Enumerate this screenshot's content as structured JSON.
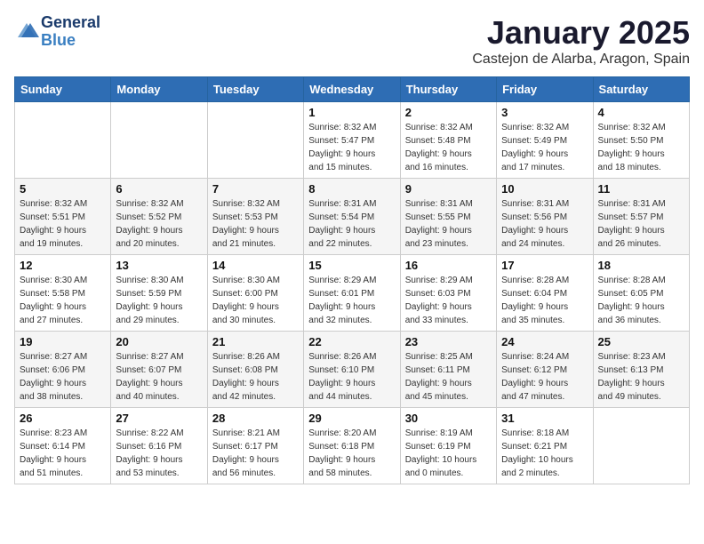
{
  "header": {
    "logo_general": "General",
    "logo_blue": "Blue",
    "month_title": "January 2025",
    "location": "Castejon de Alarba, Aragon, Spain"
  },
  "days_of_week": [
    "Sunday",
    "Monday",
    "Tuesday",
    "Wednesday",
    "Thursday",
    "Friday",
    "Saturday"
  ],
  "weeks": [
    [
      {
        "day": "",
        "detail": ""
      },
      {
        "day": "",
        "detail": ""
      },
      {
        "day": "",
        "detail": ""
      },
      {
        "day": "1",
        "detail": "Sunrise: 8:32 AM\nSunset: 5:47 PM\nDaylight: 9 hours\nand 15 minutes."
      },
      {
        "day": "2",
        "detail": "Sunrise: 8:32 AM\nSunset: 5:48 PM\nDaylight: 9 hours\nand 16 minutes."
      },
      {
        "day": "3",
        "detail": "Sunrise: 8:32 AM\nSunset: 5:49 PM\nDaylight: 9 hours\nand 17 minutes."
      },
      {
        "day": "4",
        "detail": "Sunrise: 8:32 AM\nSunset: 5:50 PM\nDaylight: 9 hours\nand 18 minutes."
      }
    ],
    [
      {
        "day": "5",
        "detail": "Sunrise: 8:32 AM\nSunset: 5:51 PM\nDaylight: 9 hours\nand 19 minutes."
      },
      {
        "day": "6",
        "detail": "Sunrise: 8:32 AM\nSunset: 5:52 PM\nDaylight: 9 hours\nand 20 minutes."
      },
      {
        "day": "7",
        "detail": "Sunrise: 8:32 AM\nSunset: 5:53 PM\nDaylight: 9 hours\nand 21 minutes."
      },
      {
        "day": "8",
        "detail": "Sunrise: 8:31 AM\nSunset: 5:54 PM\nDaylight: 9 hours\nand 22 minutes."
      },
      {
        "day": "9",
        "detail": "Sunrise: 8:31 AM\nSunset: 5:55 PM\nDaylight: 9 hours\nand 23 minutes."
      },
      {
        "day": "10",
        "detail": "Sunrise: 8:31 AM\nSunset: 5:56 PM\nDaylight: 9 hours\nand 24 minutes."
      },
      {
        "day": "11",
        "detail": "Sunrise: 8:31 AM\nSunset: 5:57 PM\nDaylight: 9 hours\nand 26 minutes."
      }
    ],
    [
      {
        "day": "12",
        "detail": "Sunrise: 8:30 AM\nSunset: 5:58 PM\nDaylight: 9 hours\nand 27 minutes."
      },
      {
        "day": "13",
        "detail": "Sunrise: 8:30 AM\nSunset: 5:59 PM\nDaylight: 9 hours\nand 29 minutes."
      },
      {
        "day": "14",
        "detail": "Sunrise: 8:30 AM\nSunset: 6:00 PM\nDaylight: 9 hours\nand 30 minutes."
      },
      {
        "day": "15",
        "detail": "Sunrise: 8:29 AM\nSunset: 6:01 PM\nDaylight: 9 hours\nand 32 minutes."
      },
      {
        "day": "16",
        "detail": "Sunrise: 8:29 AM\nSunset: 6:03 PM\nDaylight: 9 hours\nand 33 minutes."
      },
      {
        "day": "17",
        "detail": "Sunrise: 8:28 AM\nSunset: 6:04 PM\nDaylight: 9 hours\nand 35 minutes."
      },
      {
        "day": "18",
        "detail": "Sunrise: 8:28 AM\nSunset: 6:05 PM\nDaylight: 9 hours\nand 36 minutes."
      }
    ],
    [
      {
        "day": "19",
        "detail": "Sunrise: 8:27 AM\nSunset: 6:06 PM\nDaylight: 9 hours\nand 38 minutes."
      },
      {
        "day": "20",
        "detail": "Sunrise: 8:27 AM\nSunset: 6:07 PM\nDaylight: 9 hours\nand 40 minutes."
      },
      {
        "day": "21",
        "detail": "Sunrise: 8:26 AM\nSunset: 6:08 PM\nDaylight: 9 hours\nand 42 minutes."
      },
      {
        "day": "22",
        "detail": "Sunrise: 8:26 AM\nSunset: 6:10 PM\nDaylight: 9 hours\nand 44 minutes."
      },
      {
        "day": "23",
        "detail": "Sunrise: 8:25 AM\nSunset: 6:11 PM\nDaylight: 9 hours\nand 45 minutes."
      },
      {
        "day": "24",
        "detail": "Sunrise: 8:24 AM\nSunset: 6:12 PM\nDaylight: 9 hours\nand 47 minutes."
      },
      {
        "day": "25",
        "detail": "Sunrise: 8:23 AM\nSunset: 6:13 PM\nDaylight: 9 hours\nand 49 minutes."
      }
    ],
    [
      {
        "day": "26",
        "detail": "Sunrise: 8:23 AM\nSunset: 6:14 PM\nDaylight: 9 hours\nand 51 minutes."
      },
      {
        "day": "27",
        "detail": "Sunrise: 8:22 AM\nSunset: 6:16 PM\nDaylight: 9 hours\nand 53 minutes."
      },
      {
        "day": "28",
        "detail": "Sunrise: 8:21 AM\nSunset: 6:17 PM\nDaylight: 9 hours\nand 56 minutes."
      },
      {
        "day": "29",
        "detail": "Sunrise: 8:20 AM\nSunset: 6:18 PM\nDaylight: 9 hours\nand 58 minutes."
      },
      {
        "day": "30",
        "detail": "Sunrise: 8:19 AM\nSunset: 6:19 PM\nDaylight: 10 hours\nand 0 minutes."
      },
      {
        "day": "31",
        "detail": "Sunrise: 8:18 AM\nSunset: 6:21 PM\nDaylight: 10 hours\nand 2 minutes."
      },
      {
        "day": "",
        "detail": ""
      }
    ]
  ]
}
